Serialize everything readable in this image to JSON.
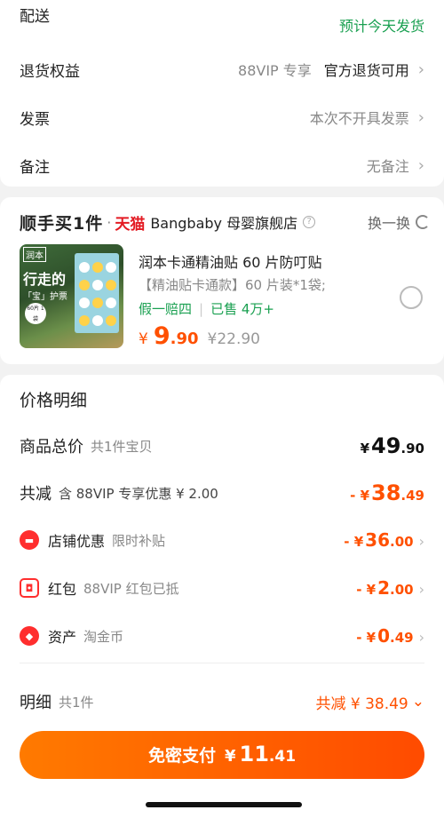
{
  "delivery": {
    "label": "配送",
    "value": "预计今天发货"
  },
  "return_rights": {
    "label": "退货权益",
    "tag": "88VIP 专享",
    "value": "官方退货可用"
  },
  "invoice": {
    "label": "发票",
    "value": "本次不开具发票"
  },
  "remark": {
    "label": "备注",
    "value": "无备注"
  },
  "shop": {
    "sf_badge": "顺手买1件",
    "tmall": "天猫",
    "name": "Bangbaby 母婴旗舰店",
    "help_icon": "?",
    "swap": "换一换"
  },
  "product": {
    "thumb_brand": "润本",
    "thumb_text1": "行走的",
    "thumb_text2": "「宝」护票",
    "thumb_badge": "60片 1袋",
    "name": "润本卡通精油贴 60 片防叮贴",
    "spec": "【精油贴卡通款】60 片装*1袋;",
    "tag1": "假一赔四",
    "tag2": "已售 4万+",
    "currency": "¥",
    "price_int": "9",
    "price_dec": ".90",
    "original_price": "¥22.90"
  },
  "price_detail": {
    "title": "价格明细",
    "total": {
      "label": "商品总价",
      "sub": "共1件宝贝",
      "cur": "¥",
      "int": "49",
      "dec": ".90"
    },
    "discount": {
      "label": "共减",
      "sub": "含 88VIP 专享优惠 ¥ 2.00",
      "cur": "- ¥",
      "int": "38",
      "dec": ".49"
    },
    "shop_discount": {
      "label": "店铺优惠",
      "sub": "限时补贴",
      "cur": "- ¥",
      "int": "36",
      "dec": ".00"
    },
    "red_packet": {
      "label": "红包",
      "sub": "88VIP 红包已抵",
      "cur": "- ¥",
      "int": "2",
      "dec": ".00"
    },
    "assets": {
      "label": "资产",
      "sub": "淘金币",
      "cur": "- ¥",
      "int": "0",
      "dec": ".49"
    }
  },
  "detail_bar": {
    "label": "明细",
    "sub": "共1件",
    "saving": "共减 ¥ 38.49"
  },
  "pay_button": {
    "label": "免密支付",
    "cur": "¥",
    "int": "11",
    "dec": ".41"
  },
  "colors": {
    "accent": "#ff5000",
    "green": "#1aa051",
    "tmall_red": "#e31b23"
  }
}
